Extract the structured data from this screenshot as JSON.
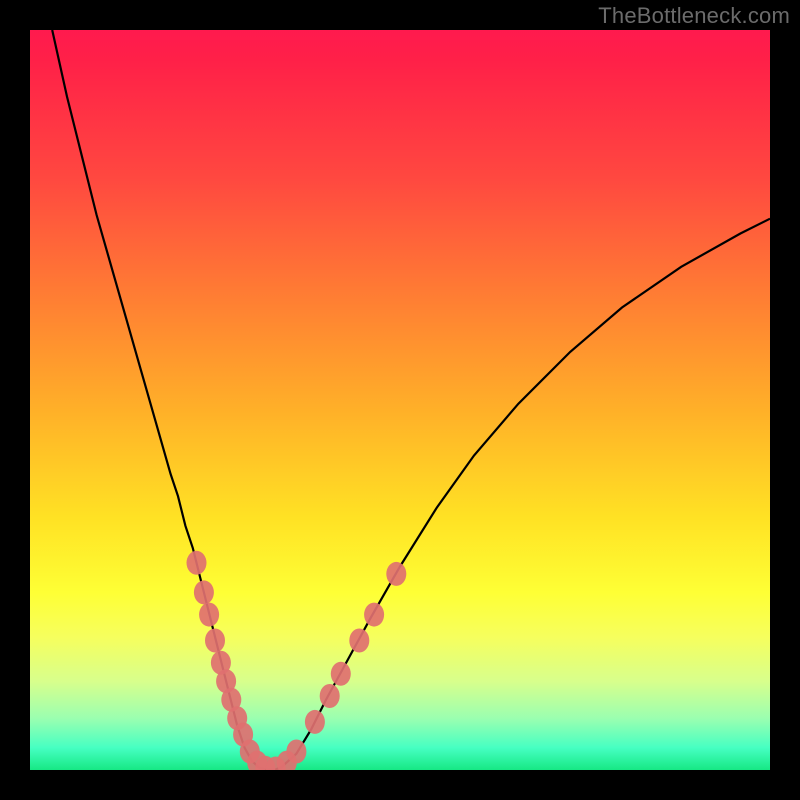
{
  "watermark": "TheBottleneck.com",
  "chart_data": {
    "type": "line",
    "title": "",
    "xlabel": "",
    "ylabel": "",
    "xlim": [
      0,
      100
    ],
    "ylim": [
      0,
      100
    ],
    "grid": false,
    "legend": false,
    "series": [
      {
        "name": "bottleneck-curve",
        "x": [
          3,
          5,
          7,
          9,
          11,
          13,
          15,
          17,
          19,
          20,
          21,
          22,
          23,
          24,
          25,
          26,
          27,
          28,
          29,
          30,
          31,
          32,
          33,
          34,
          36,
          38,
          40,
          43,
          46,
          50,
          55,
          60,
          66,
          73,
          80,
          88,
          96,
          100
        ],
        "values": [
          100,
          91,
          83,
          75,
          68,
          61,
          54,
          47,
          40,
          37,
          33,
          30,
          26,
          22,
          18,
          14,
          10,
          6,
          3,
          1.2,
          0.3,
          0,
          0,
          0.4,
          2.2,
          5.5,
          9.5,
          15,
          20.5,
          27.5,
          35.5,
          42.5,
          49.5,
          56.5,
          62.5,
          68,
          72.5,
          74.5
        ]
      }
    ],
    "markers": [
      {
        "x": 22.5,
        "y": 28.0
      },
      {
        "x": 23.5,
        "y": 24.0
      },
      {
        "x": 24.2,
        "y": 21.0
      },
      {
        "x": 25.0,
        "y": 17.5
      },
      {
        "x": 25.8,
        "y": 14.5
      },
      {
        "x": 26.5,
        "y": 12.0
      },
      {
        "x": 27.2,
        "y": 9.5
      },
      {
        "x": 28.0,
        "y": 7.0
      },
      {
        "x": 28.8,
        "y": 4.8
      },
      {
        "x": 29.7,
        "y": 2.5
      },
      {
        "x": 30.7,
        "y": 1.0
      },
      {
        "x": 31.8,
        "y": 0.3
      },
      {
        "x": 33.2,
        "y": 0.2
      },
      {
        "x": 34.7,
        "y": 1.0
      },
      {
        "x": 36.0,
        "y": 2.5
      },
      {
        "x": 38.5,
        "y": 6.5
      },
      {
        "x": 40.5,
        "y": 10.0
      },
      {
        "x": 42.0,
        "y": 13.0
      },
      {
        "x": 44.5,
        "y": 17.5
      },
      {
        "x": 46.5,
        "y": 21.0
      },
      {
        "x": 49.5,
        "y": 26.5
      }
    ],
    "gradient_stops": [
      {
        "pos": 0,
        "color": "#ff1a4e"
      },
      {
        "pos": 20,
        "color": "#ff4840"
      },
      {
        "pos": 35,
        "color": "#ff7a34"
      },
      {
        "pos": 52,
        "color": "#ffb228"
      },
      {
        "pos": 66,
        "color": "#ffe224"
      },
      {
        "pos": 76,
        "color": "#feff35"
      },
      {
        "pos": 88,
        "color": "#d8ff8c"
      },
      {
        "pos": 97,
        "color": "#46ffc2"
      },
      {
        "pos": 100,
        "color": "#16e884"
      }
    ],
    "marker_color": "#e07070",
    "curve_color": "#000000"
  }
}
